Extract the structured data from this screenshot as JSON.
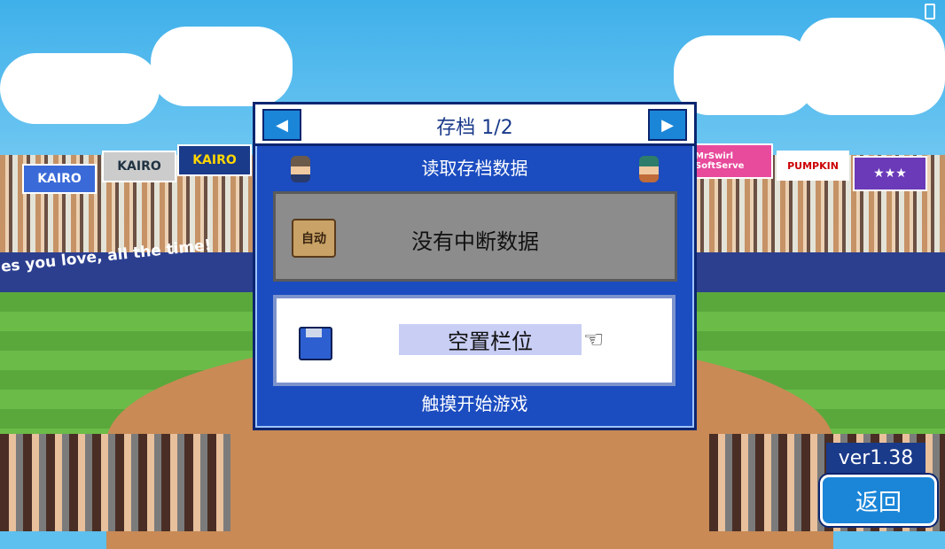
{
  "dialog": {
    "title": "存档 1/2",
    "subtitle": "读取存档数据",
    "slot1_label": "没有中断数据",
    "slot1_icon_text": "自动",
    "slot2_label": "空置栏位",
    "touch_prompt": "触摸开始游戏"
  },
  "background": {
    "wall_text": "es you love, all the time!",
    "banners": [
      "KAIRO",
      "KAIRO",
      "KAIRO",
      "MrSwirl SoftServe",
      "PUMPKIN",
      "★★★"
    ]
  },
  "version": "ver1.38",
  "back_button": "返回",
  "icons": {
    "prev": "left-arrow-icon",
    "next": "right-arrow-icon",
    "auto_save": "auto-save-icon",
    "disk": "floppy-disk-icon",
    "pointer": "pointing-hand-icon"
  },
  "colors": {
    "dialog_bg": "#1b4cc0",
    "accent": "#1b86d8",
    "slot_highlight": "#c9cef5"
  }
}
